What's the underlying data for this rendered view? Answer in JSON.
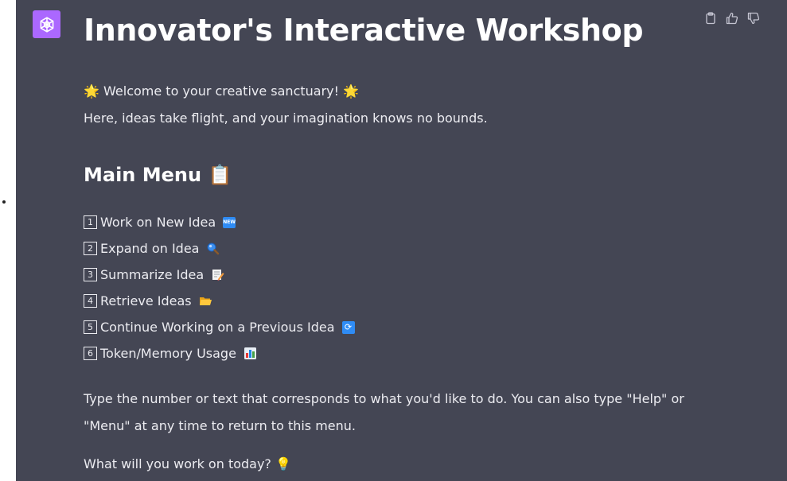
{
  "header": {
    "title": "Innovator's Interactive Workshop"
  },
  "intro": {
    "welcome": "Welcome to your creative sanctuary!",
    "welcome_emoji": "🌟",
    "tagline": "Here, ideas take flight, and your imagination knows no bounds."
  },
  "menu": {
    "heading": "Main Menu",
    "heading_emoji": "📋",
    "items": [
      {
        "number": "1",
        "label": "Work on New Idea",
        "icon": "new-badge-icon"
      },
      {
        "number": "2",
        "label": "Expand on Idea",
        "icon": "magnifier-icon"
      },
      {
        "number": "3",
        "label": "Summarize Idea",
        "icon": "memo-icon"
      },
      {
        "number": "4",
        "label": "Retrieve Ideas",
        "icon": "folder-icon"
      },
      {
        "number": "5",
        "label": "Continue Working on a Previous Idea",
        "icon": "repeat-icon"
      },
      {
        "number": "6",
        "label": "Token/Memory Usage",
        "icon": "bar-chart-icon"
      }
    ]
  },
  "footer": {
    "instructions": "Type the number or text that corresponds to what you'd like to do. You can also type \"Help\" or \"Menu\" at any time to return to this menu.",
    "question": "What will you work on today?",
    "question_emoji": "💡"
  },
  "colors": {
    "panel_bg": "#444654",
    "avatar_bg": "#ab68ff",
    "text": "#ececf1",
    "icon_gray": "#c5c5d2"
  }
}
